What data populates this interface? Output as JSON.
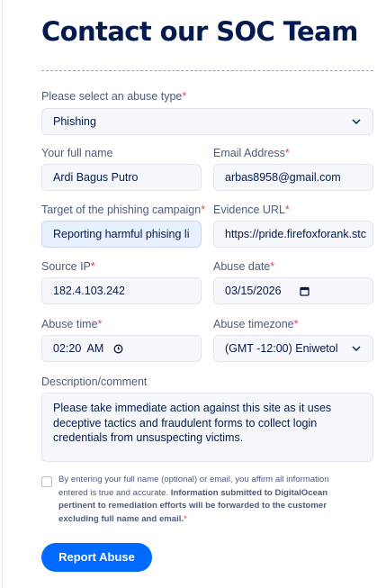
{
  "page": {
    "title": "Contact our SOC Team"
  },
  "form": {
    "abuse_type": {
      "label": "Please select an abuse type",
      "value": "Phishing"
    },
    "full_name": {
      "label": "Your full name",
      "value": "Ardi Bagus Putro"
    },
    "email": {
      "label": "Email Address",
      "value": "arbas8958@gmail.com"
    },
    "target": {
      "label": "Target of the phishing campaign",
      "value": "Reporting harmful phising lin"
    },
    "evidence_url": {
      "label": "Evidence URL",
      "value": "https://pride.firefoxforank.stc"
    },
    "source_ip": {
      "label": "Source IP",
      "value": "182.4.103.242"
    },
    "abuse_date": {
      "label": "Abuse date",
      "value": "03/15/2026"
    },
    "abuse_time": {
      "label": "Abuse time",
      "value": "02:20  AM"
    },
    "abuse_timezone": {
      "label": "Abuse timezone",
      "value": "(GMT -12:00) Eniwetol"
    },
    "description": {
      "label": "Description/comment",
      "value": "Please take immediate action against this site as it uses deceptive tactics and fraudulent forms to collect login credentials from unsuspecting victims."
    },
    "required_marker": "*",
    "consent": {
      "text_plain": "By entering your full name (optional) or email, you affirm all information entered is true and accurate. ",
      "text_bold": "Information submitted to DigitalOcean pertinent to remediation efforts will be forwarded to the customer excluding full name and email."
    },
    "submit_label": "Report Abuse"
  },
  "icons": {
    "dropdown": "chevron-down-icon",
    "date": "calendar-icon",
    "time": "clock-icon"
  },
  "colors": {
    "primary": "#0069ff",
    "required": "#e5405e",
    "heading": "#031b4e",
    "field_bg": "#f5f7fb",
    "autofill_bg": "#e8f0fe"
  }
}
